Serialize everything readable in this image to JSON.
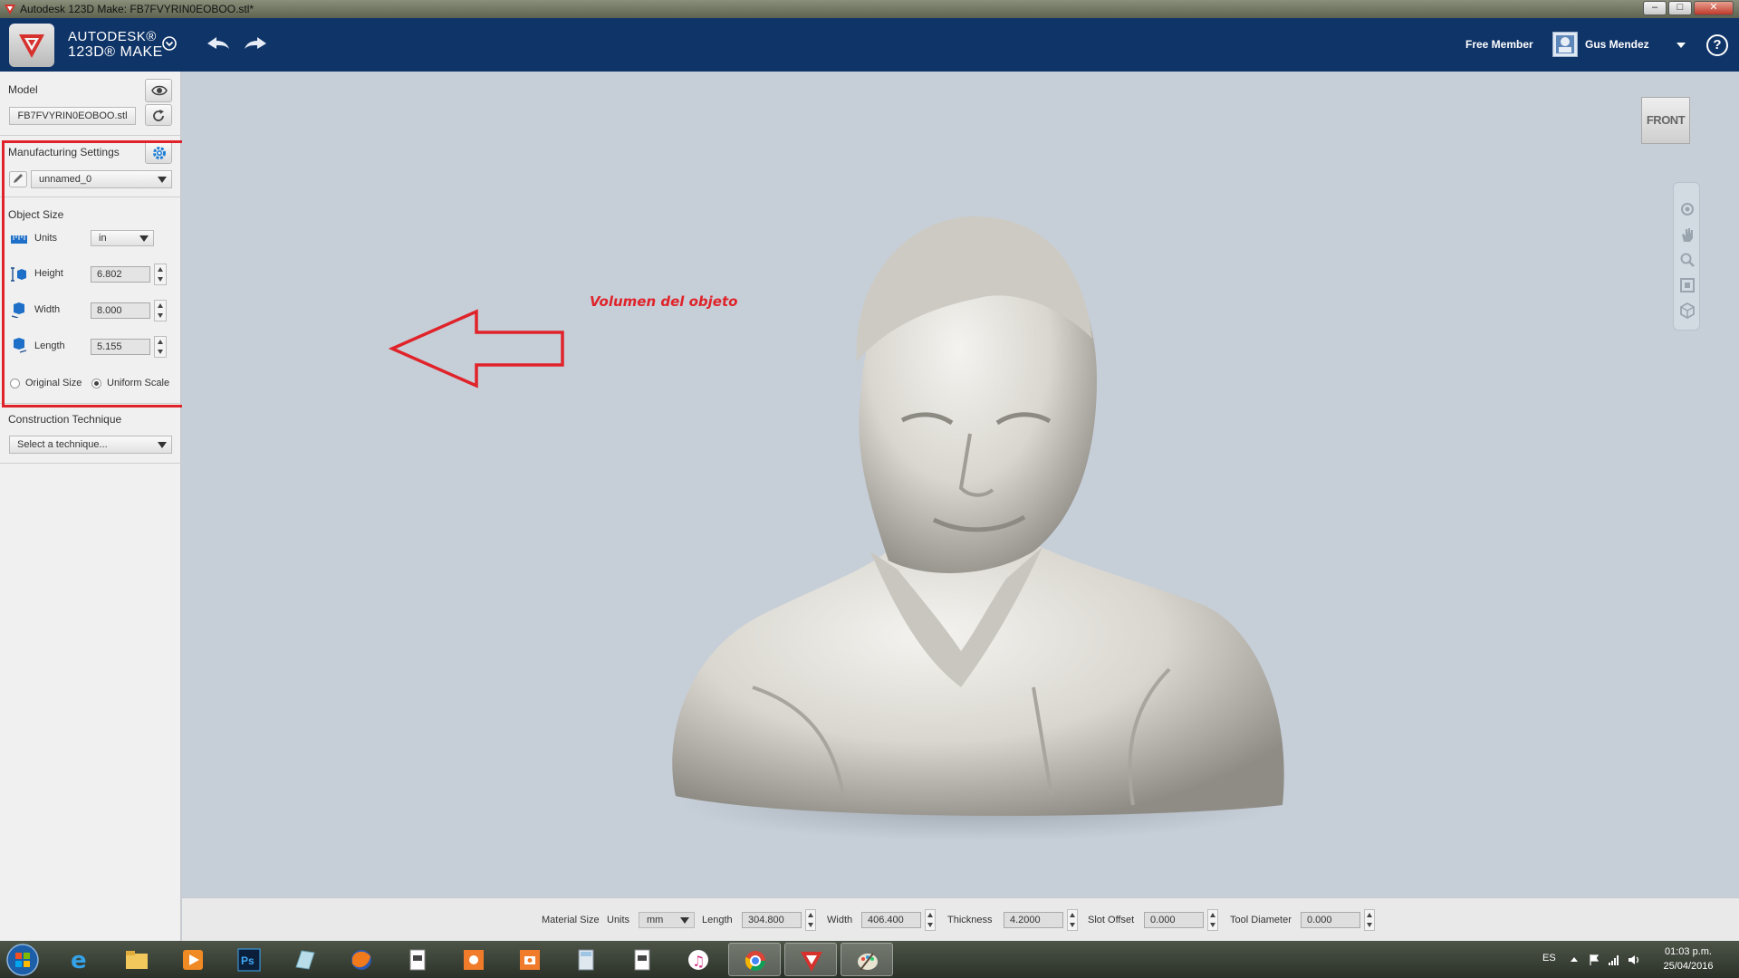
{
  "window": {
    "title": "Autodesk 123D Make: FB7FVYRIN0EOBOO.stl*",
    "minimize": "–",
    "maximize": "□",
    "close": "✕"
  },
  "header": {
    "brand_line1": "AUTODESK®",
    "brand_line2": "123D® MAKE",
    "member_status": "Free Member",
    "username": "Gus Mendez",
    "help_label": "?"
  },
  "panel": {
    "model_label": "Model",
    "model_file": "FB7FVYRIN0EOBOO.stl",
    "manufacturing_label": "Manufacturing Settings",
    "preset": "unnamed_0",
    "object_size_label": "Object Size",
    "units_label": "Units",
    "units_value": "in",
    "height_label": "Height",
    "height_value": "6.802",
    "width_label": "Width",
    "width_value": "8.000",
    "length_label": "Length",
    "length_value": "5.155",
    "original_size_label": "Original Size",
    "uniform_scale_label": "Uniform Scale",
    "construction_label": "Construction Technique",
    "technique_placeholder": "Select a technique..."
  },
  "viewport": {
    "view_cube_label": "FRONT",
    "annotation": "Volumen del objeto"
  },
  "material": {
    "material_size_label": "Material Size",
    "units_label": "Units",
    "units_value": "mm",
    "length_label": "Length",
    "length_value": "304.800",
    "width_label": "Width",
    "width_value": "406.400",
    "thickness_label": "Thickness",
    "thickness_value": "4.2000",
    "slot_offset_label": "Slot Offset",
    "slot_offset_value": "0.000",
    "tool_diameter_label": "Tool Diameter",
    "tool_diameter_value": "0.000"
  },
  "taskbar": {
    "language": "ES",
    "time": "01:03 p.m.",
    "date": "25/04/2016"
  },
  "colors": {
    "header_bg": "#0f3468",
    "annotation_red": "#e0232a",
    "viewport_bg": "#c6cfd8"
  }
}
